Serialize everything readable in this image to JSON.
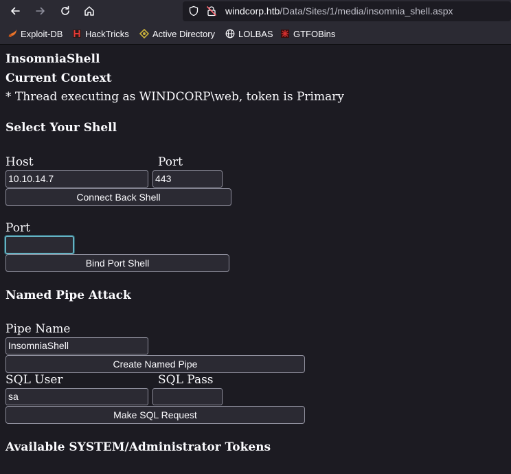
{
  "browser": {
    "url_host": "windcorp.htb",
    "url_path": "/Data/Sites/1/media/insomnia_shell.aspx",
    "bookmarks": [
      {
        "label": "Exploit-DB",
        "icon": "exploit-db-icon"
      },
      {
        "label": "HackTricks",
        "icon": "hacktricks-icon"
      },
      {
        "label": "Active Directory",
        "icon": "active-directory-icon"
      },
      {
        "label": "LOLBAS",
        "icon": "globe-icon"
      },
      {
        "label": "GTFOBins",
        "icon": "gtfobins-icon"
      }
    ]
  },
  "page": {
    "title": "InsomniaShell",
    "context_heading": "Current Context",
    "context_line": "* Thread executing as WINDCORP\\web, token is Primary",
    "shell_heading": "Select Your Shell",
    "host_label": "Host",
    "port_label": "Port",
    "host_value": "10.10.14.7",
    "port_value": "443",
    "connect_back_button": "Connect Back Shell",
    "bind_port_label": "Port",
    "bind_port_value": "",
    "bind_port_button": "Bind Port Shell",
    "pipe_heading": "Named Pipe Attack",
    "pipe_name_label": "Pipe Name",
    "pipe_name_value": "InsomniaShell",
    "create_pipe_button": "Create Named Pipe",
    "sql_user_label": "SQL User",
    "sql_pass_label": "SQL Pass",
    "sql_user_value": "sa",
    "sql_pass_value": "",
    "sql_button": "Make SQL Request",
    "tokens_heading": "Available SYSTEM/Administrator Tokens"
  }
}
